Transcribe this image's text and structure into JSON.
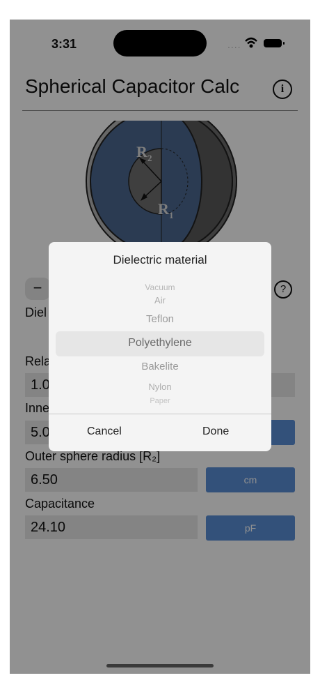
{
  "status_bar": {
    "time": "3:31",
    "signal": "....",
    "wifi_icon": "wifi-icon",
    "battery_icon": "battery-icon"
  },
  "header": {
    "title": "Spherical Capacitor Calc",
    "info_icon": "i"
  },
  "diagram": {
    "outer_label": "R",
    "outer_sub": "2",
    "inner_label": "R",
    "inner_sub": "1"
  },
  "controls": {
    "stepper_label": "−",
    "help_icon": "?"
  },
  "form": {
    "dielectric_label": "Diel",
    "relative_label": "Rela",
    "relative_value": "1.0",
    "inner_label": "Inne",
    "inner_value": "5.0",
    "outer_label": "Outer sphere radius [R₂]",
    "outer_value": "6.50",
    "outer_unit": "cm",
    "capacitance_label": "Capacitance",
    "capacitance_value": "24.10",
    "capacitance_unit": "pF"
  },
  "dialog": {
    "title": "Dielectric material",
    "options": [
      "Vacuum",
      "Air",
      "Teflon",
      "Polyethylene",
      "Bakelite",
      "Nylon",
      "Paper"
    ],
    "selected": "Polyethylene",
    "cancel_label": "Cancel",
    "done_label": "Done"
  },
  "colors": {
    "accent": "#5b8fd6",
    "sphere_fill": "#4c6991",
    "overlay": "rgba(0,0,0,0.43)"
  }
}
